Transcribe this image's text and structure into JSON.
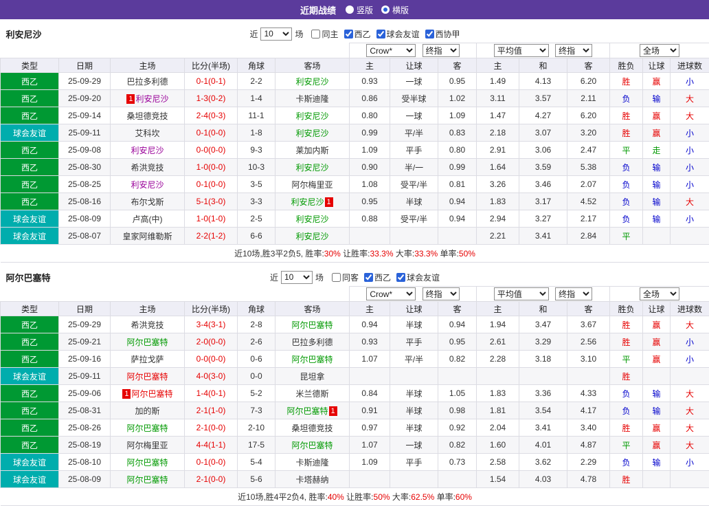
{
  "colors": {
    "topbar": "#5B3B9C",
    "red": "#E60000",
    "blue": "#0000CC",
    "green": "#009900",
    "purple": "#990099",
    "dark": "#333333",
    "accent_blue": "#2A62D9"
  },
  "type_colors": {
    "西乙": "#009933",
    "球会友谊": "#00ADAD"
  },
  "topbar": {
    "title": "近期战绩",
    "radios": [
      {
        "label": "竖版",
        "selected": false
      },
      {
        "label": "横版",
        "selected": true
      }
    ]
  },
  "sections": [
    {
      "team": "利安尼沙",
      "filter": {
        "near": "近",
        "count": "10",
        "unit": "场",
        "checkboxes": [
          {
            "label": "同主",
            "checked": false
          },
          {
            "label": "西乙",
            "checked": true
          },
          {
            "label": "球会友谊",
            "checked": true
          },
          {
            "label": "西协甲",
            "checked": true
          }
        ]
      },
      "dropdowns": {
        "company": "Crow*",
        "index_a": "终指",
        "average": "平均值",
        "index_b": "终指",
        "scope": "全场"
      },
      "columns": [
        "类型",
        "日期",
        "主场",
        "比分(半场)",
        "角球",
        "客场",
        "主",
        "让球",
        "客",
        "主",
        "和",
        "客",
        "胜负",
        "让球",
        "进球数"
      ],
      "rows": [
        {
          "type": "西乙",
          "date": "25-09-29",
          "home": {
            "text": "巴拉多利德",
            "color": "dark"
          },
          "score": "0-1(0-1)",
          "corner": "2-2",
          "away": {
            "text": "利安尼沙",
            "color": "green"
          },
          "ah": [
            "0.93",
            "一球",
            "0.95"
          ],
          "eu": [
            "1.49",
            "4.13",
            "6.20"
          ],
          "result": {
            "text": "胜",
            "color": "red"
          },
          "let": {
            "text": "赢",
            "color": "red"
          },
          "goals": {
            "text": "小",
            "color": "blue"
          }
        },
        {
          "type": "西乙",
          "date": "25-09-20",
          "home": {
            "text": "利安尼沙",
            "color": "purple",
            "badge_pre": "1"
          },
          "score": "1-3(0-2)",
          "corner": "1-4",
          "away": {
            "text": "卡斯迪隆",
            "color": "dark"
          },
          "ah": [
            "0.86",
            "受半球",
            "1.02"
          ],
          "eu": [
            "3.11",
            "3.57",
            "2.11"
          ],
          "result": {
            "text": "负",
            "color": "blue"
          },
          "let": {
            "text": "输",
            "color": "blue"
          },
          "goals": {
            "text": "大",
            "color": "red"
          }
        },
        {
          "type": "西乙",
          "date": "25-09-14",
          "home": {
            "text": "桑坦德竞技",
            "color": "dark"
          },
          "score": "2-4(0-3)",
          "corner": "11-1",
          "away": {
            "text": "利安尼沙",
            "color": "green"
          },
          "ah": [
            "0.80",
            "一球",
            "1.09"
          ],
          "eu": [
            "1.47",
            "4.27",
            "6.20"
          ],
          "result": {
            "text": "胜",
            "color": "red"
          },
          "let": {
            "text": "赢",
            "color": "red"
          },
          "goals": {
            "text": "大",
            "color": "red"
          }
        },
        {
          "type": "球会友谊",
          "date": "25-09-11",
          "home": {
            "text": "艾科坎",
            "color": "dark"
          },
          "score": "0-1(0-0)",
          "corner": "1-8",
          "away": {
            "text": "利安尼沙",
            "color": "green"
          },
          "ah": [
            "0.99",
            "平/半",
            "0.83"
          ],
          "eu": [
            "2.18",
            "3.07",
            "3.20"
          ],
          "result": {
            "text": "胜",
            "color": "red"
          },
          "let": {
            "text": "赢",
            "color": "red"
          },
          "goals": {
            "text": "小",
            "color": "blue"
          }
        },
        {
          "type": "西乙",
          "date": "25-09-08",
          "home": {
            "text": "利安尼沙",
            "color": "purple"
          },
          "score": "0-0(0-0)",
          "corner": "9-3",
          "away": {
            "text": "莱加内斯",
            "color": "dark"
          },
          "ah": [
            "1.09",
            "平手",
            "0.80"
          ],
          "eu": [
            "2.91",
            "3.06",
            "2.47"
          ],
          "result": {
            "text": "平",
            "color": "green"
          },
          "let": {
            "text": "走",
            "color": "green"
          },
          "goals": {
            "text": "小",
            "color": "blue"
          }
        },
        {
          "type": "西乙",
          "date": "25-08-30",
          "home": {
            "text": "希洪竞技",
            "color": "dark"
          },
          "score": "1-0(0-0)",
          "corner": "10-3",
          "away": {
            "text": "利安尼沙",
            "color": "green"
          },
          "ah": [
            "0.90",
            "半/一",
            "0.99"
          ],
          "eu": [
            "1.64",
            "3.59",
            "5.38"
          ],
          "result": {
            "text": "负",
            "color": "blue"
          },
          "let": {
            "text": "输",
            "color": "blue"
          },
          "goals": {
            "text": "小",
            "color": "blue"
          }
        },
        {
          "type": "西乙",
          "date": "25-08-25",
          "home": {
            "text": "利安尼沙",
            "color": "purple"
          },
          "score": "0-1(0-0)",
          "corner": "3-5",
          "away": {
            "text": "阿尔梅里亚",
            "color": "dark"
          },
          "ah": [
            "1.08",
            "受平/半",
            "0.81"
          ],
          "eu": [
            "3.26",
            "3.46",
            "2.07"
          ],
          "result": {
            "text": "负",
            "color": "blue"
          },
          "let": {
            "text": "输",
            "color": "blue"
          },
          "goals": {
            "text": "小",
            "color": "blue"
          }
        },
        {
          "type": "西乙",
          "date": "25-08-16",
          "home": {
            "text": "布尔戈斯",
            "color": "dark"
          },
          "score": "5-1(3-0)",
          "corner": "3-3",
          "away": {
            "text": "利安尼沙",
            "color": "green",
            "badge_post": "1"
          },
          "ah": [
            "0.95",
            "半球",
            "0.94"
          ],
          "eu": [
            "1.83",
            "3.17",
            "4.52"
          ],
          "result": {
            "text": "负",
            "color": "blue"
          },
          "let": {
            "text": "输",
            "color": "blue"
          },
          "goals": {
            "text": "大",
            "color": "red"
          }
        },
        {
          "type": "球会友谊",
          "date": "25-08-09",
          "home": {
            "text": "卢高(中)",
            "color": "dark"
          },
          "score": "1-0(1-0)",
          "corner": "2-5",
          "away": {
            "text": "利安尼沙",
            "color": "green"
          },
          "ah": [
            "0.88",
            "受平/半",
            "0.94"
          ],
          "eu": [
            "2.94",
            "3.27",
            "2.17"
          ],
          "result": {
            "text": "负",
            "color": "blue"
          },
          "let": {
            "text": "输",
            "color": "blue"
          },
          "goals": {
            "text": "小",
            "color": "blue"
          }
        },
        {
          "type": "球会友谊",
          "date": "25-08-07",
          "home": {
            "text": "皇家阿维勒斯",
            "color": "dark"
          },
          "score": "2-2(1-2)",
          "corner": "6-6",
          "away": {
            "text": "利安尼沙",
            "color": "green"
          },
          "ah": [
            "",
            "",
            ""
          ],
          "eu": [
            "2.21",
            "3.41",
            "2.84"
          ],
          "result": {
            "text": "平",
            "color": "green"
          },
          "let": {
            "text": "",
            "color": "dark"
          },
          "goals": {
            "text": "",
            "color": "dark"
          }
        }
      ],
      "summary": [
        {
          "text": "近10场,胜3平2负5, ",
          "color": "dark"
        },
        {
          "text": "胜率:",
          "color": "dark"
        },
        {
          "text": "30%",
          "color": "red"
        },
        {
          "text": " 让胜率:",
          "color": "dark"
        },
        {
          "text": "33.3%",
          "color": "red"
        },
        {
          "text": " 大率:",
          "color": "dark"
        },
        {
          "text": "33.3%",
          "color": "red"
        },
        {
          "text": " 单率:",
          "color": "dark"
        },
        {
          "text": "50%",
          "color": "red"
        }
      ]
    },
    {
      "team": "阿尔巴塞特",
      "filter": {
        "near": "近",
        "count": "10",
        "unit": "场",
        "checkboxes": [
          {
            "label": "同客",
            "checked": false
          },
          {
            "label": "西乙",
            "checked": true
          },
          {
            "label": "球会友谊",
            "checked": true
          }
        ]
      },
      "dropdowns": {
        "company": "Crow*",
        "index_a": "终指",
        "average": "平均值",
        "index_b": "终指",
        "scope": "全场"
      },
      "columns": [
        "类型",
        "日期",
        "主场",
        "比分(半场)",
        "角球",
        "客场",
        "主",
        "让球",
        "客",
        "主",
        "和",
        "客",
        "胜负",
        "让球",
        "进球数"
      ],
      "rows": [
        {
          "type": "西乙",
          "date": "25-09-29",
          "home": {
            "text": "希洪竞技",
            "color": "dark"
          },
          "score": "3-4(3-1)",
          "corner": "2-8",
          "away": {
            "text": "阿尔巴塞特",
            "color": "green"
          },
          "ah": [
            "0.94",
            "半球",
            "0.94"
          ],
          "eu": [
            "1.94",
            "3.47",
            "3.67"
          ],
          "result": {
            "text": "胜",
            "color": "red"
          },
          "let": {
            "text": "赢",
            "color": "red"
          },
          "goals": {
            "text": "大",
            "color": "red"
          }
        },
        {
          "type": "西乙",
          "date": "25-09-21",
          "home": {
            "text": "阿尔巴塞特",
            "color": "green"
          },
          "score": "2-0(0-0)",
          "corner": "2-6",
          "away": {
            "text": "巴拉多利德",
            "color": "dark"
          },
          "ah": [
            "0.93",
            "平手",
            "0.95"
          ],
          "eu": [
            "2.61",
            "3.29",
            "2.56"
          ],
          "result": {
            "text": "胜",
            "color": "red"
          },
          "let": {
            "text": "赢",
            "color": "red"
          },
          "goals": {
            "text": "小",
            "color": "blue"
          }
        },
        {
          "type": "西乙",
          "date": "25-09-16",
          "home": {
            "text": "萨拉戈萨",
            "color": "dark"
          },
          "score": "0-0(0-0)",
          "corner": "0-6",
          "away": {
            "text": "阿尔巴塞特",
            "color": "green"
          },
          "ah": [
            "1.07",
            "平/半",
            "0.82"
          ],
          "eu": [
            "2.28",
            "3.18",
            "3.10"
          ],
          "result": {
            "text": "平",
            "color": "green"
          },
          "let": {
            "text": "赢",
            "color": "red"
          },
          "goals": {
            "text": "小",
            "color": "blue"
          }
        },
        {
          "type": "球会友谊",
          "date": "25-09-11",
          "home": {
            "text": "阿尔巴塞特",
            "color": "red"
          },
          "score": "4-0(3-0)",
          "corner": "0-0",
          "away": {
            "text": "昆坦拿",
            "color": "dark"
          },
          "ah": [
            "",
            "",
            ""
          ],
          "eu": [
            "",
            "",
            ""
          ],
          "result": {
            "text": "胜",
            "color": "red"
          },
          "let": {
            "text": "",
            "color": "dark"
          },
          "goals": {
            "text": "",
            "color": "dark"
          }
        },
        {
          "type": "西乙",
          "date": "25-09-06",
          "home": {
            "text": "阿尔巴塞特",
            "color": "red",
            "badge_pre": "1"
          },
          "score": "1-4(0-1)",
          "corner": "5-2",
          "away": {
            "text": "米兰德斯",
            "color": "dark"
          },
          "ah": [
            "0.84",
            "半球",
            "1.05"
          ],
          "eu": [
            "1.83",
            "3.36",
            "4.33"
          ],
          "result": {
            "text": "负",
            "color": "blue"
          },
          "let": {
            "text": "输",
            "color": "blue"
          },
          "goals": {
            "text": "大",
            "color": "red"
          }
        },
        {
          "type": "西乙",
          "date": "25-08-31",
          "home": {
            "text": "加的斯",
            "color": "dark"
          },
          "score": "2-1(1-0)",
          "corner": "7-3",
          "away": {
            "text": "阿尔巴塞特",
            "color": "green",
            "badge_post": "1"
          },
          "ah": [
            "0.91",
            "半球",
            "0.98"
          ],
          "eu": [
            "1.81",
            "3.54",
            "4.17"
          ],
          "result": {
            "text": "负",
            "color": "blue"
          },
          "let": {
            "text": "输",
            "color": "blue"
          },
          "goals": {
            "text": "大",
            "color": "red"
          }
        },
        {
          "type": "西乙",
          "date": "25-08-26",
          "home": {
            "text": "阿尔巴塞特",
            "color": "green"
          },
          "score": "2-1(0-0)",
          "corner": "2-10",
          "away": {
            "text": "桑坦德竞技",
            "color": "dark"
          },
          "ah": [
            "0.97",
            "半球",
            "0.92"
          ],
          "eu": [
            "2.04",
            "3.41",
            "3.40"
          ],
          "result": {
            "text": "胜",
            "color": "red"
          },
          "let": {
            "text": "赢",
            "color": "red"
          },
          "goals": {
            "text": "大",
            "color": "red"
          }
        },
        {
          "type": "西乙",
          "date": "25-08-19",
          "home": {
            "text": "阿尔梅里亚",
            "color": "dark"
          },
          "score": "4-4(1-1)",
          "corner": "17-5",
          "away": {
            "text": "阿尔巴塞特",
            "color": "green"
          },
          "ah": [
            "1.07",
            "一球",
            "0.82"
          ],
          "eu": [
            "1.60",
            "4.01",
            "4.87"
          ],
          "result": {
            "text": "平",
            "color": "green"
          },
          "let": {
            "text": "赢",
            "color": "red"
          },
          "goals": {
            "text": "大",
            "color": "red"
          }
        },
        {
          "type": "球会友谊",
          "date": "25-08-10",
          "home": {
            "text": "阿尔巴塞特",
            "color": "green"
          },
          "score": "0-1(0-0)",
          "corner": "5-4",
          "away": {
            "text": "卡斯迪隆",
            "color": "dark"
          },
          "ah": [
            "1.09",
            "平手",
            "0.73"
          ],
          "eu": [
            "2.58",
            "3.62",
            "2.29"
          ],
          "result": {
            "text": "负",
            "color": "blue"
          },
          "let": {
            "text": "输",
            "color": "blue"
          },
          "goals": {
            "text": "小",
            "color": "blue"
          }
        },
        {
          "type": "球会友谊",
          "date": "25-08-09",
          "home": {
            "text": "阿尔巴塞特",
            "color": "green"
          },
          "score": "2-1(0-0)",
          "corner": "5-6",
          "away": {
            "text": "卡塔赫纳",
            "color": "dark"
          },
          "ah": [
            "",
            "",
            ""
          ],
          "eu": [
            "1.54",
            "4.03",
            "4.78"
          ],
          "result": {
            "text": "胜",
            "color": "red"
          },
          "let": {
            "text": "",
            "color": "dark"
          },
          "goals": {
            "text": "",
            "color": "dark"
          }
        }
      ],
      "summary": [
        {
          "text": "近10场,胜4平2负4, ",
          "color": "dark"
        },
        {
          "text": "胜率:",
          "color": "dark"
        },
        {
          "text": "40%",
          "color": "red"
        },
        {
          "text": " 让胜率:",
          "color": "dark"
        },
        {
          "text": "50%",
          "color": "red"
        },
        {
          "text": " 大率:",
          "color": "dark"
        },
        {
          "text": "62.5%",
          "color": "red"
        },
        {
          "text": " 单率:",
          "color": "dark"
        },
        {
          "text": "60%",
          "color": "red"
        }
      ]
    }
  ]
}
